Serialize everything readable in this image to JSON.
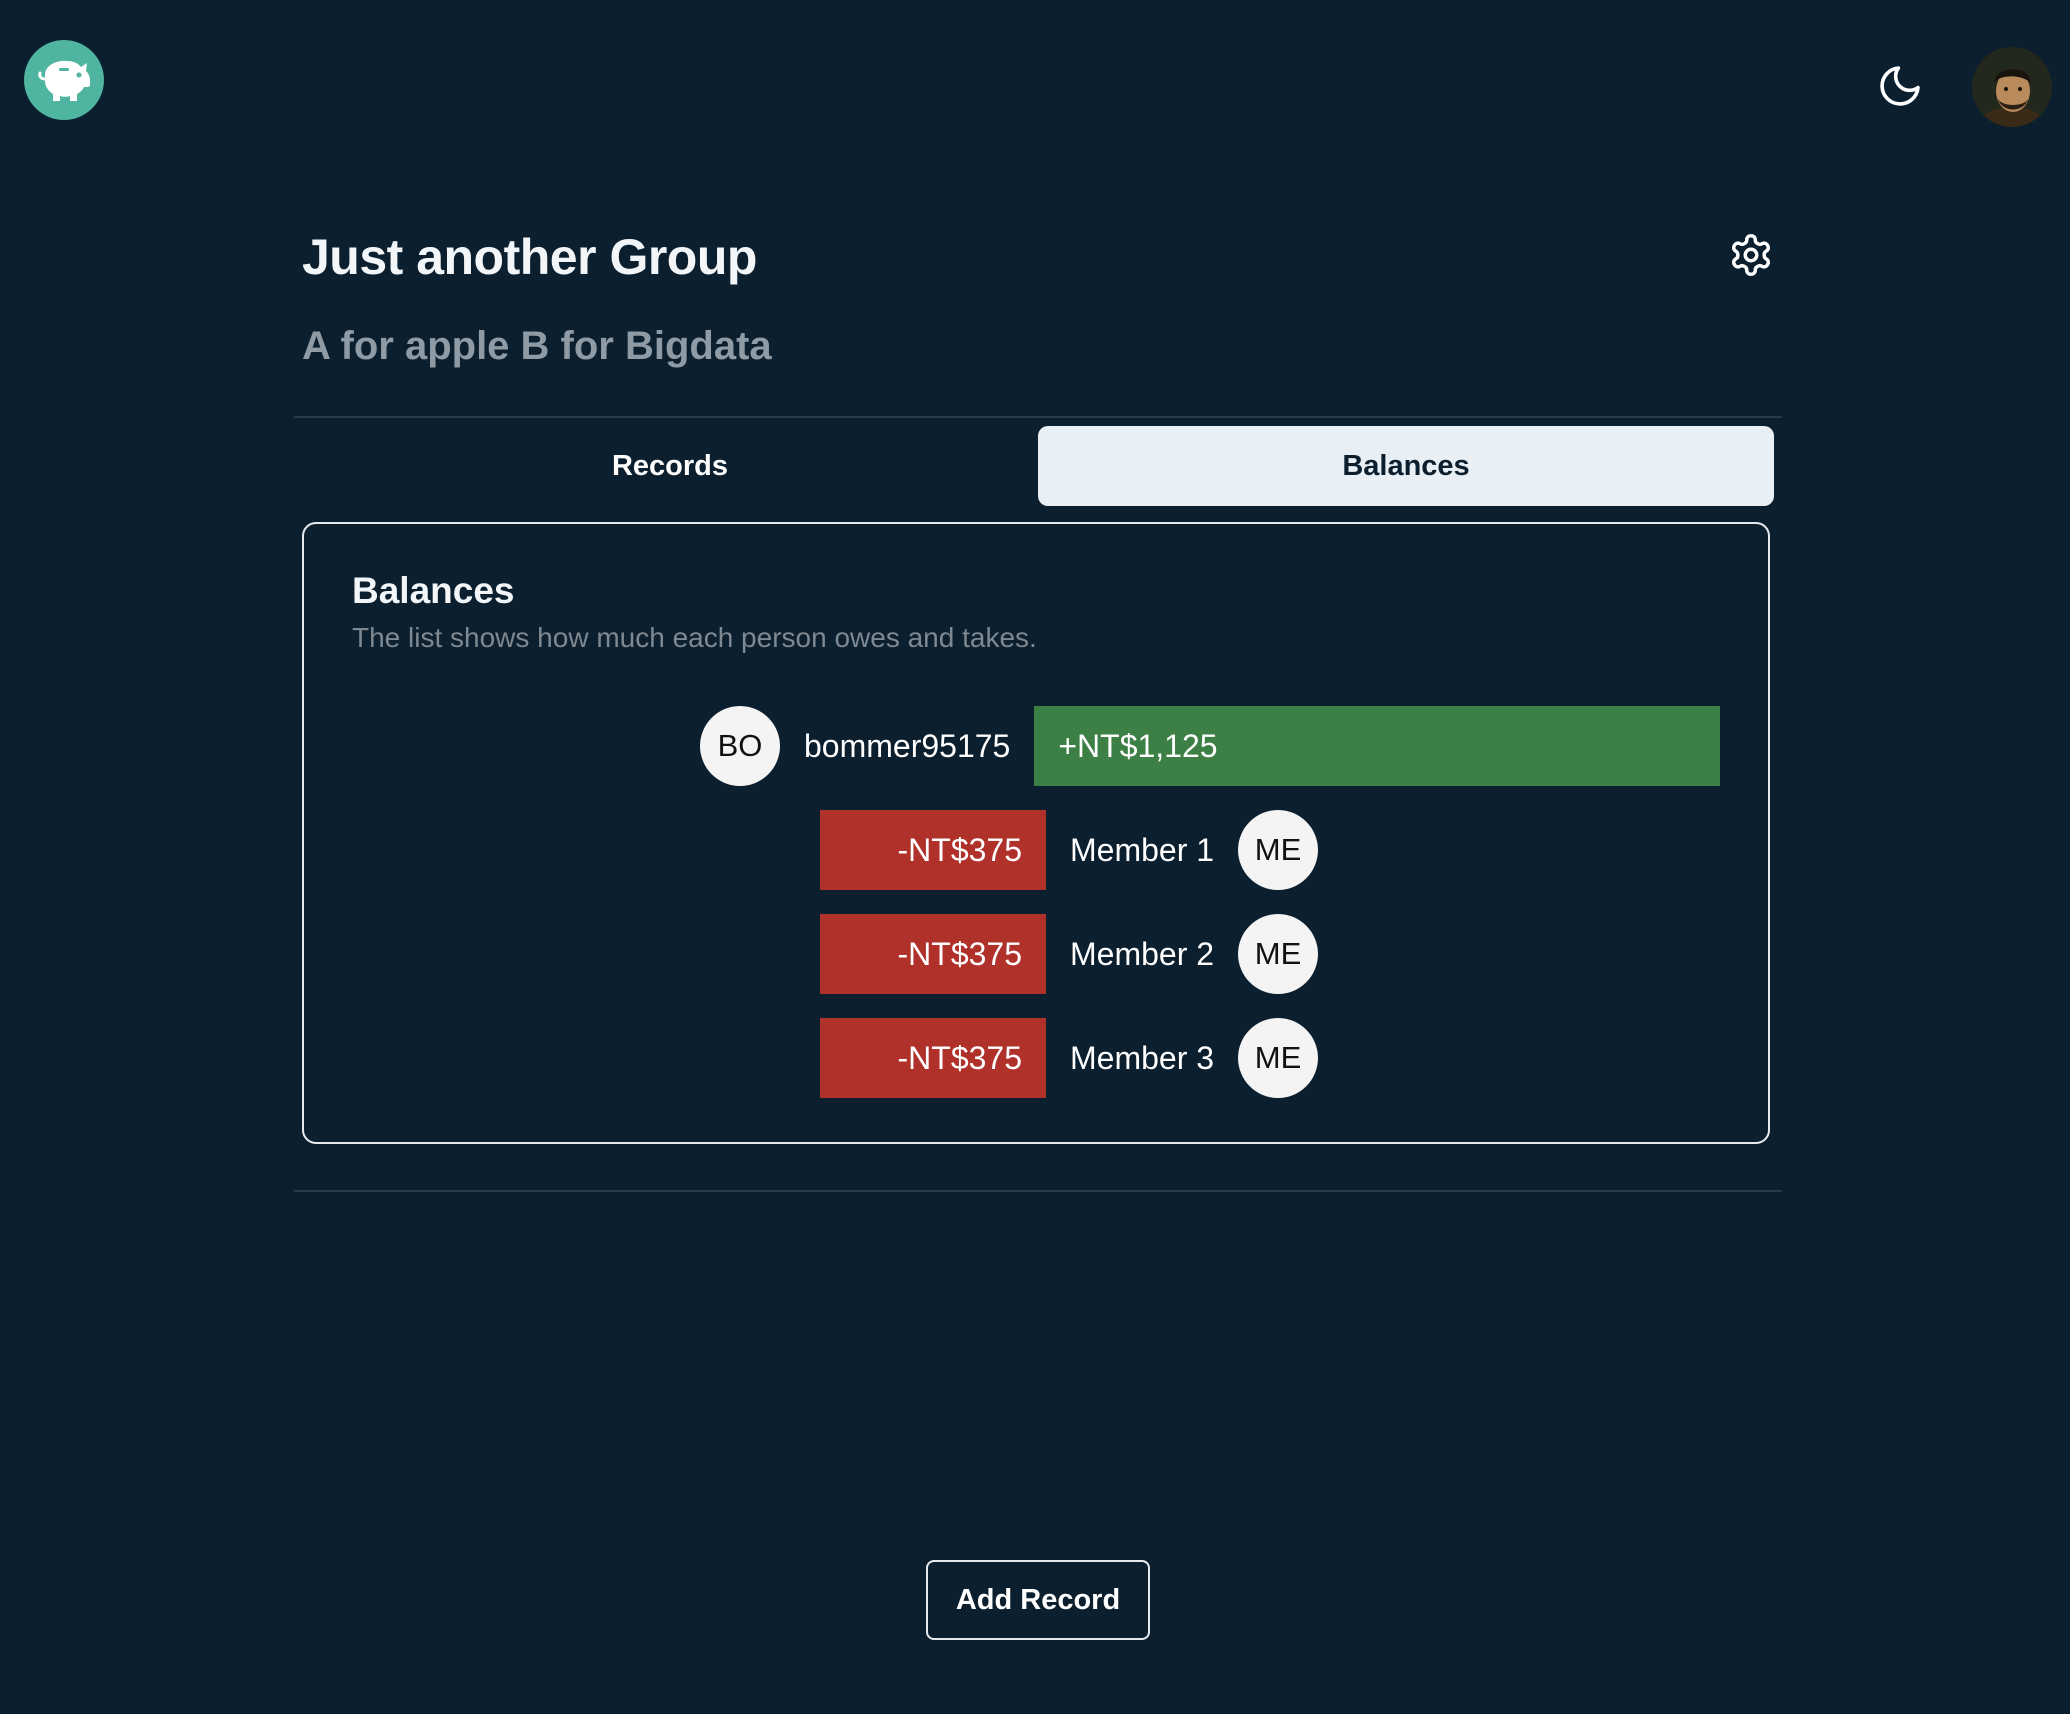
{
  "header": {
    "logo_icon": "piggy-bank-icon",
    "theme_icon": "moon-icon",
    "user_avatar": "user-avatar-photo"
  },
  "group": {
    "title": "Just another Group",
    "description": "A for apple B for Bigdata",
    "settings_icon": "gear-icon"
  },
  "tabs": [
    {
      "label": "Records",
      "active": false
    },
    {
      "label": "Balances",
      "active": true
    }
  ],
  "balances": {
    "title": "Balances",
    "subtitle": "The list shows how much each person owes and takes.",
    "positive_color": "#3d8046",
    "negative_color": "#b0302a",
    "items": [
      {
        "initials": "BO",
        "name": "bommer95175",
        "amount": "+NT$1,125",
        "value": 1125
      },
      {
        "initials": "ME",
        "name": "Member 1",
        "amount": "-NT$375",
        "value": -375
      },
      {
        "initials": "ME",
        "name": "Member 2",
        "amount": "-NT$375",
        "value": -375
      },
      {
        "initials": "ME",
        "name": "Member 3",
        "amount": "-NT$375",
        "value": -375
      }
    ]
  },
  "actions": {
    "add_record_label": "Add Record"
  },
  "colors": {
    "background": "#0c1f2e",
    "logo_accent": "#4fb5a1",
    "active_tab_bg": "#e8f0f5"
  }
}
